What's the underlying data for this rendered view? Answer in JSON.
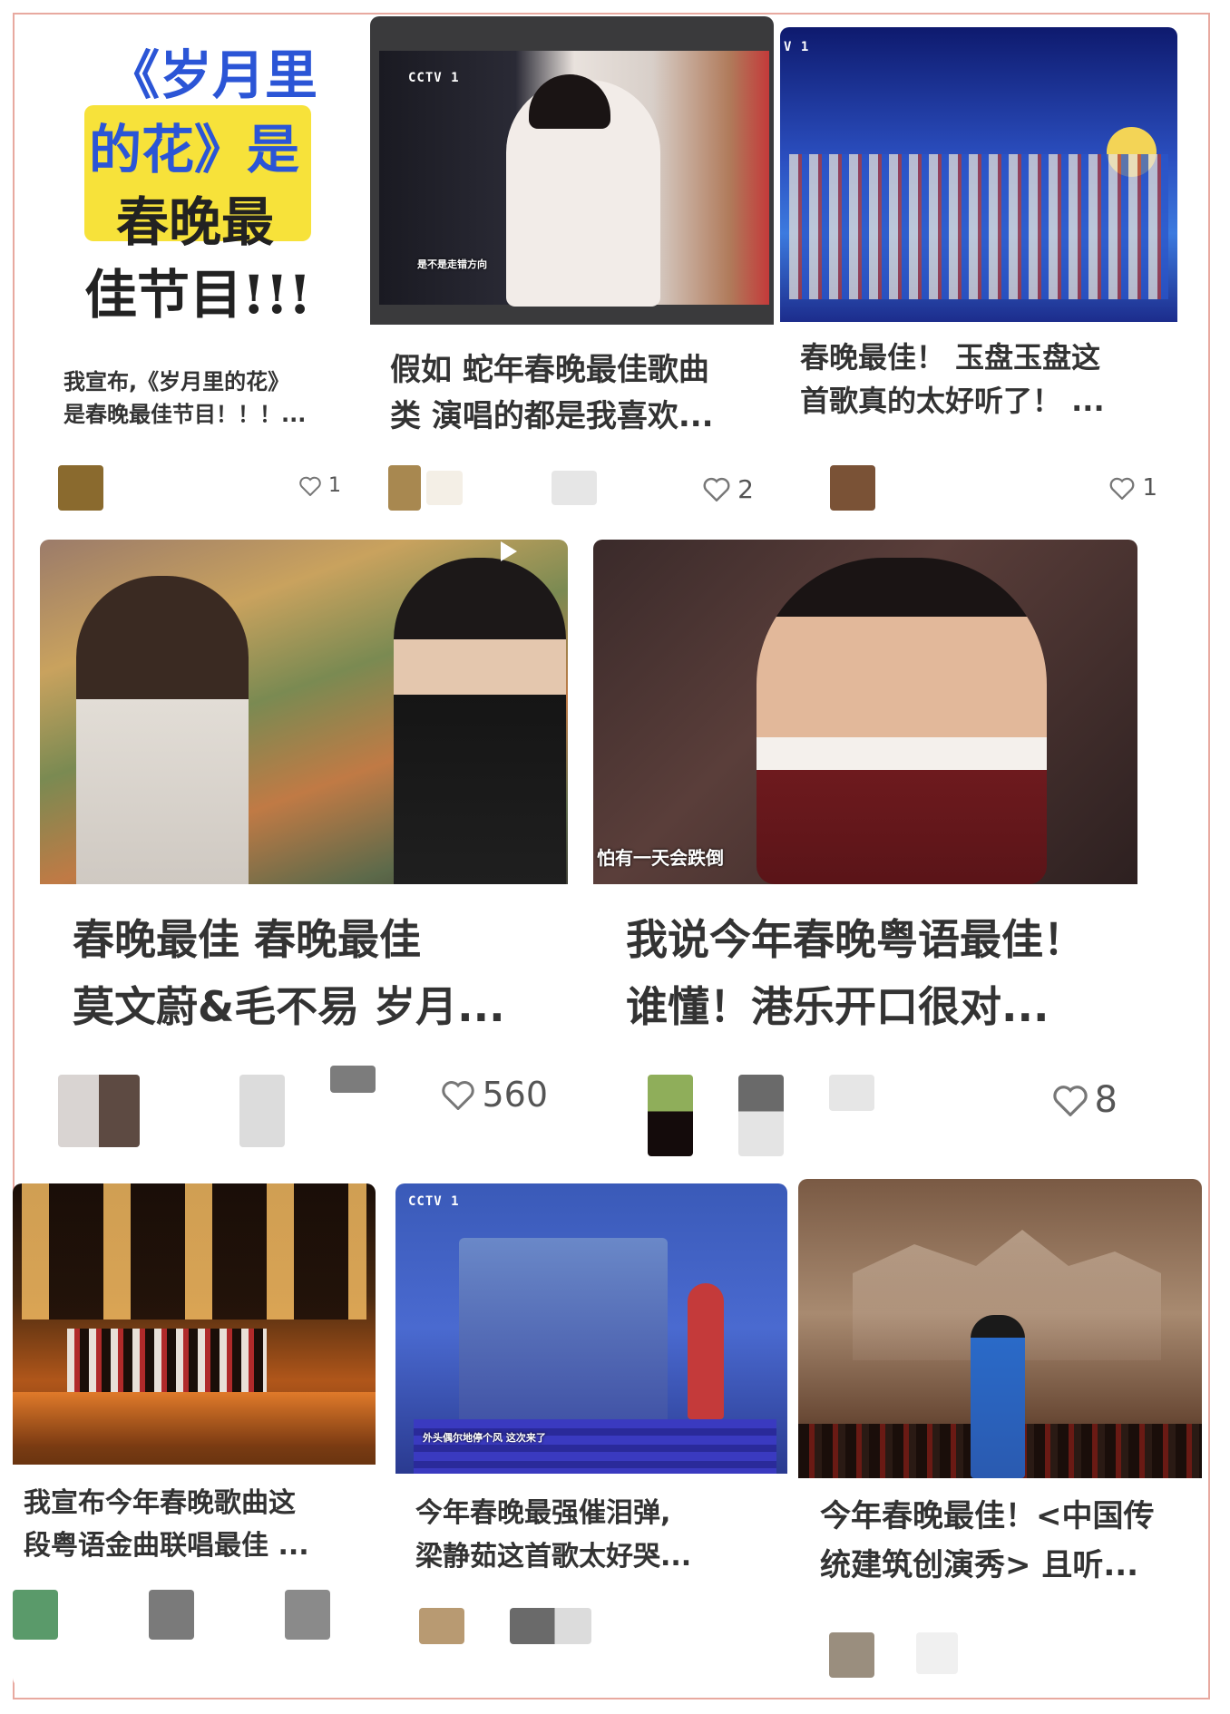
{
  "feed": {
    "cards": [
      {
        "poster_lines": [
          "《岁月里",
          "的花》是",
          "春晚最",
          "佳节目!!!"
        ],
        "title_line1": "我宣布,《岁月里的花》",
        "title_line2": "是春晚最佳节目！！！...",
        "likes": "1",
        "icon": "heart-icon"
      },
      {
        "logo": "CCTV 1",
        "caption": "是不是走错方向",
        "title_line1": "假如 蛇年春晚最佳歌曲",
        "title_line2": "类 演唱的都是我喜欢...",
        "likes": "2",
        "icon": "heart-icon"
      },
      {
        "logo": "V 1",
        "title_line1": "春晚最佳！ 玉盘玉盘这",
        "title_line2": "首歌真的太好听了！ ...",
        "likes": "1",
        "icon": "heart-icon"
      },
      {
        "title_line1": "春晚最佳 春晚最佳",
        "title_line2": "莫文蔚&毛不易    岁月...",
        "likes": "560",
        "icon": "heart-icon",
        "video": true
      },
      {
        "caption": "怕有一天会跌倒",
        "title_line1": "我说今年春晚粤语最佳！",
        "title_line2": "谁懂！港乐开口很对...",
        "likes": "8",
        "icon": "heart-icon"
      },
      {
        "title_line1": "我宣布今年春晚歌曲这",
        "title_line2": "段粤语金曲联唱最佳 ..."
      },
      {
        "logo": "CCTV 1",
        "caption": "外头偶尔地停个风 这次来了",
        "title_line1": "今年春晚最强催泪弹,",
        "title_line2": "梁静茹这首歌太好哭..."
      },
      {
        "title_line1": "今年春晚最佳！<中国传",
        "title_line2": "统建筑创演秀> 且听..."
      }
    ]
  },
  "colors": {
    "poster_highlight": "#f7e23a",
    "poster_blue": "#2b55d6",
    "heart": "#777777"
  }
}
